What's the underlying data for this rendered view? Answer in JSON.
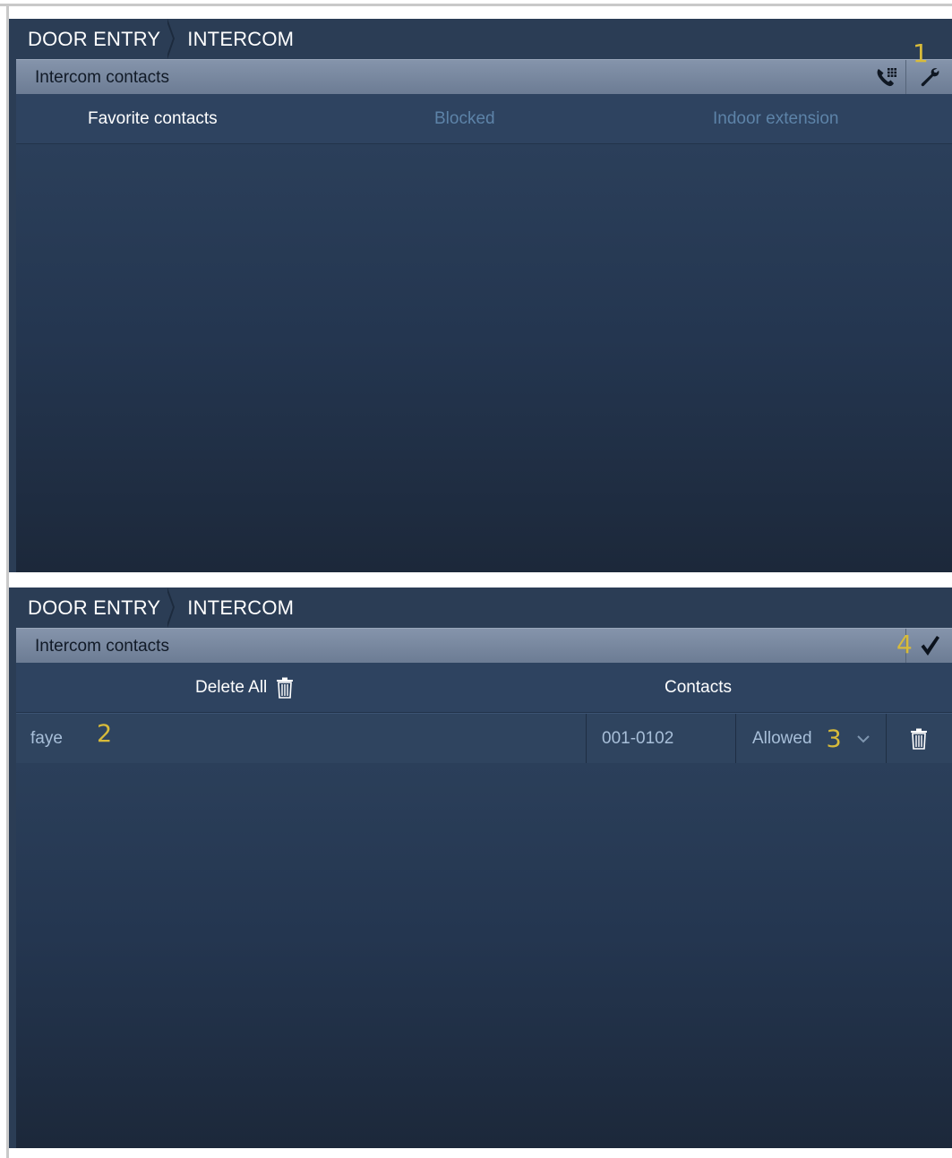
{
  "panels": [
    {
      "breadcrumb": [
        "DOOR ENTRY",
        "INTERCOM"
      ],
      "title": "Intercom contacts",
      "tabs": [
        {
          "label": "Favorite contacts",
          "state": "active"
        },
        {
          "label": "Blocked",
          "state": "inactive"
        },
        {
          "label": "Indoor extension",
          "state": "inactive"
        }
      ],
      "icons": [
        "phone-keypad-icon",
        "wrench-icon"
      ],
      "markers": [
        "1"
      ]
    },
    {
      "breadcrumb": [
        "DOOR ENTRY",
        "INTERCOM"
      ],
      "title": "Intercom contacts",
      "header": {
        "delete_all": "Delete All",
        "contacts": "Contacts"
      },
      "rows": [
        {
          "name": "faye",
          "number": "001-0102",
          "status": "Allowed"
        }
      ],
      "icons": [
        "checkmark-icon",
        "trash-icon",
        "chevron-down-icon"
      ],
      "markers": [
        "2",
        "3",
        "4"
      ]
    }
  ],
  "colors": {
    "background": "#2b3d55",
    "titlebar": "#7a89a0",
    "marker": "#d8bb3a",
    "inactive_tab": "#5d83a8"
  }
}
